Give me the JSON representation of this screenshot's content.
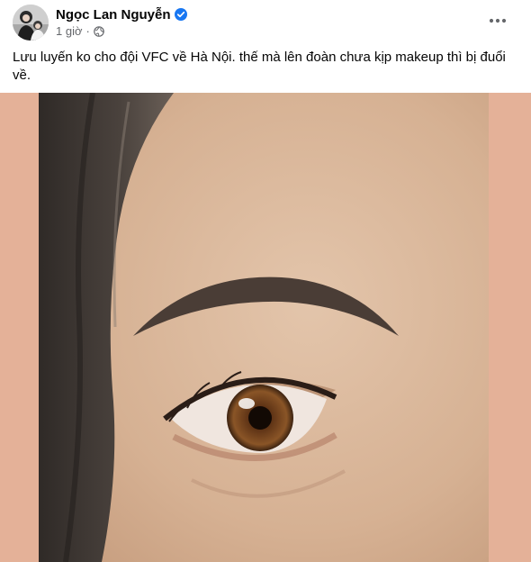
{
  "post": {
    "author": "Ngọc Lan Nguyễn",
    "time": "1 giờ",
    "separator": "·",
    "caption": "Lưu luyến ko cho đội VFC về Hà Nội. thế mà lên đoàn chưa kịp makeup thì bị đuổi về."
  },
  "icons": {
    "verified": "verified-badge-icon",
    "audience": "globe-icon",
    "more": "more-options-icon"
  },
  "colors": {
    "verified_blue": "#1877f2",
    "secondary_text": "#65676b",
    "media_background": "#e4b198"
  }
}
